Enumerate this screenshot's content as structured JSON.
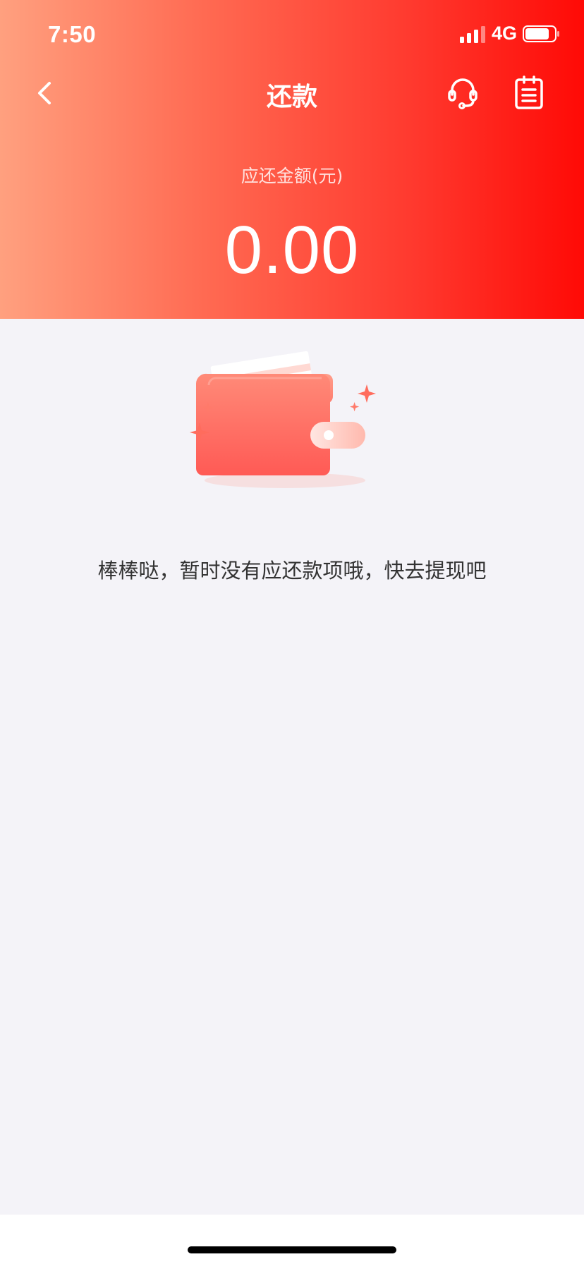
{
  "status_bar": {
    "time": "7:50",
    "network": "4G"
  },
  "nav": {
    "title": "还款",
    "icons": {
      "back": "back-arrow-icon",
      "service": "customer-service-headset-icon",
      "record": "clipboard-record-icon"
    }
  },
  "summary": {
    "amount_label": "应还金额(元)",
    "amount_value": "0.00"
  },
  "empty_state": {
    "illustration": "wallet-icon",
    "message": "棒棒哒，暂时没有应还款项哦，快去提现吧"
  },
  "colors": {
    "header_gradient_start": "#ffa07f",
    "header_gradient_end": "#ff0a06",
    "page_background": "#f4f3f8",
    "wallet_red": "#ff5f57"
  }
}
